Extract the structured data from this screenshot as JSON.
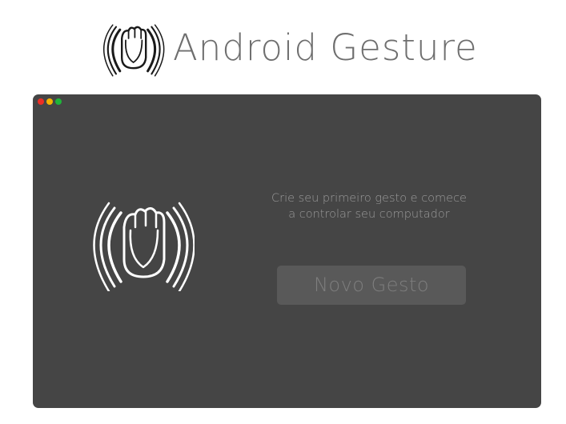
{
  "header": {
    "title": "Android Gesture",
    "logo_icon": "gesture-hand-icon",
    "title_color": "#6f6f6f"
  },
  "window": {
    "background": "#454545",
    "controls": {
      "close_color": "#ee2e24",
      "minimize_color": "#f5b400",
      "maximize_color": "#1fb53a"
    },
    "prompt_line1": "Crie seu primeiro gesto e comece",
    "prompt_line2": "a controlar seu computador",
    "new_gesture_label": "Novo Gesto",
    "logo_icon": "gesture-hand-icon"
  }
}
